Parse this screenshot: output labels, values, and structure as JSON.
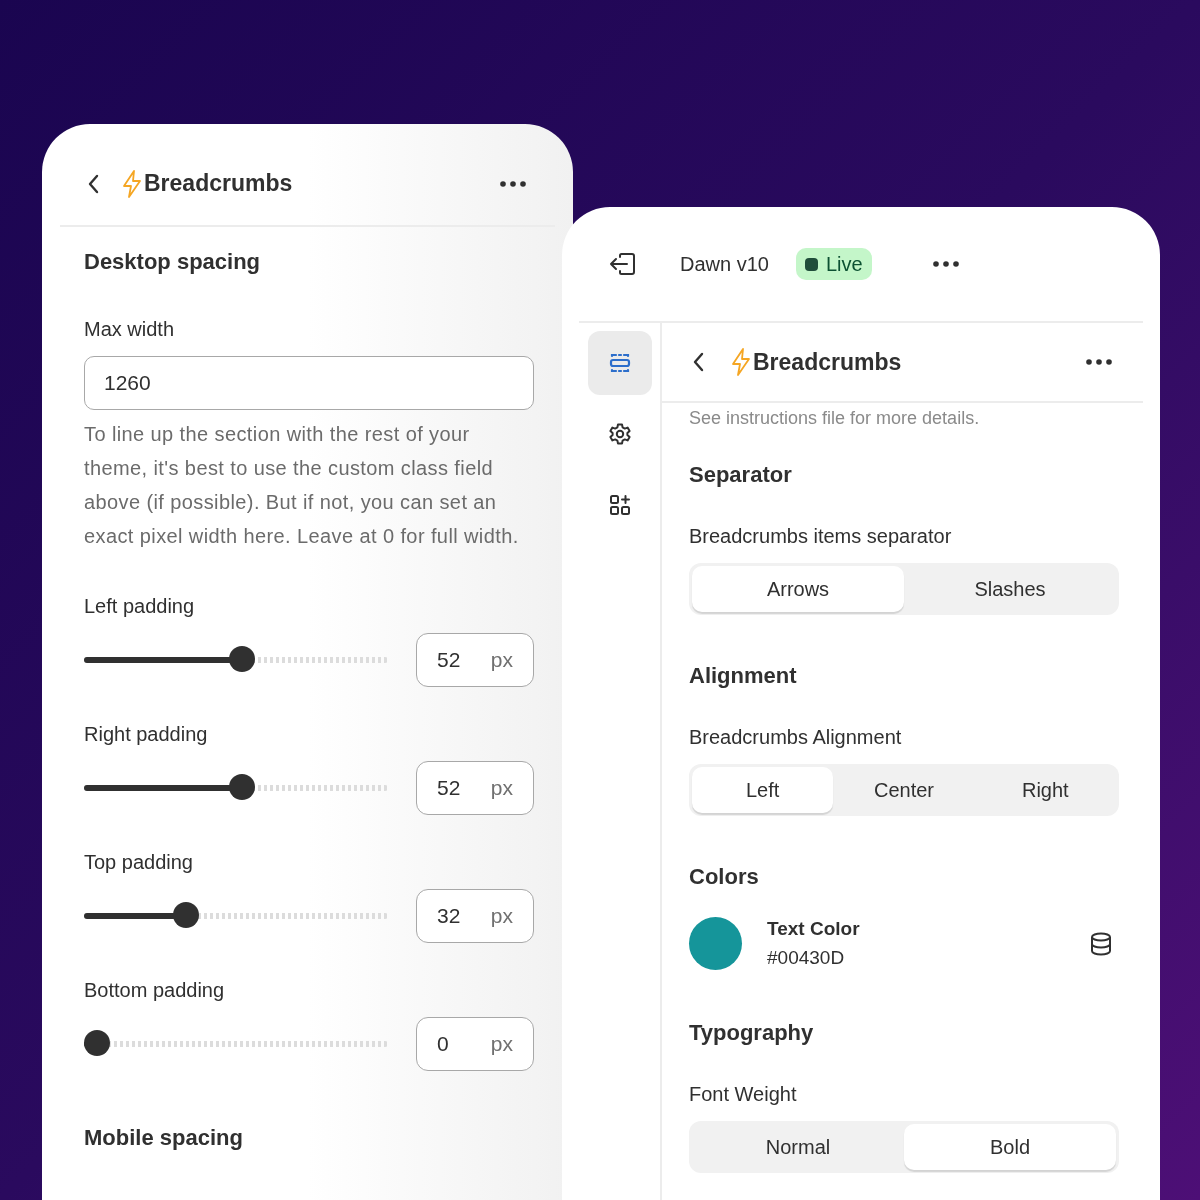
{
  "left_panel": {
    "title": "Breadcrumbs",
    "section_heading": "Desktop spacing",
    "max_width": {
      "label": "Max width",
      "value": "1260",
      "help": "To line up the section with the rest of your theme, it's best to use the custom class field above (if possible). But if not, you can set an exact pixel width here. Leave at 0 for full width."
    },
    "sliders": [
      {
        "label": "Left padding",
        "level": 0.52,
        "value": "52",
        "unit": "px"
      },
      {
        "label": "Right padding",
        "level": 0.52,
        "value": "52",
        "unit": "px"
      },
      {
        "label": "Top padding",
        "level": 0.32,
        "value": "32",
        "unit": "px"
      },
      {
        "label": "Bottom padding",
        "level": 0,
        "value": "0",
        "unit": "px"
      }
    ],
    "next_section_heading": "Mobile spacing"
  },
  "right_panel": {
    "theme_name": "Dawn v10",
    "status_badge": "Live",
    "rail": [
      {
        "kind": "sections",
        "selected": true
      },
      {
        "kind": "settings",
        "selected": false
      },
      {
        "kind": "apps",
        "selected": false
      }
    ],
    "title": "Breadcrumbs",
    "note": "See instructions file for more details.",
    "sections": [
      {
        "kind": "segmented",
        "heading": "Separator",
        "label": "Breadcrumbs items separator",
        "options": [
          {
            "label": "Arrows",
            "selected": true
          },
          {
            "label": "Slashes",
            "selected": false
          }
        ]
      },
      {
        "kind": "segmented",
        "heading": "Alignment",
        "label": "Breadcrumbs Alignment",
        "options": [
          {
            "label": "Left",
            "selected": true
          },
          {
            "label": "Center",
            "selected": false
          },
          {
            "label": "Right",
            "selected": false
          }
        ]
      },
      {
        "kind": "color",
        "heading": "Colors",
        "label": "Text Color",
        "value": "#00430D",
        "color": "#15959a"
      },
      {
        "kind": "segmented",
        "heading": "Typography",
        "label": "Font Weight",
        "options": [
          {
            "label": "Normal",
            "selected": false
          },
          {
            "label": "Bold",
            "selected": true
          }
        ]
      }
    ]
  }
}
